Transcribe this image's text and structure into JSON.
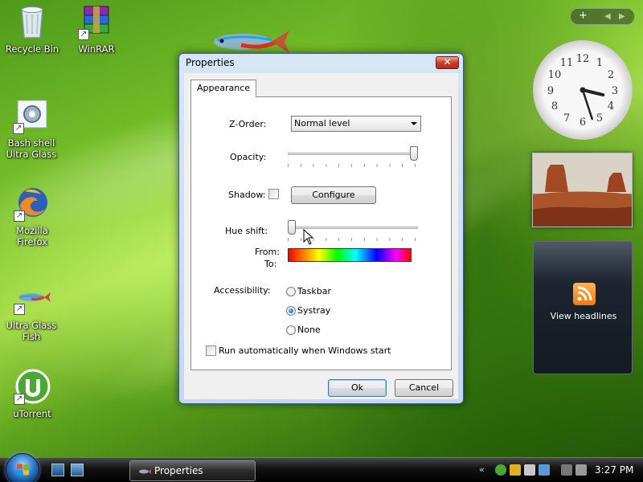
{
  "desktop": {
    "icons": [
      {
        "label": "Recycle Bin"
      },
      {
        "label": "WinRAR"
      },
      {
        "label": "Bash shell Ultra Glass"
      },
      {
        "label": "Mozilla Firefox"
      },
      {
        "label": "Ultra Glass Fish"
      },
      {
        "label": "uTorrent"
      }
    ]
  },
  "dialog": {
    "title": "Properties",
    "close_label": "✕",
    "tab": "Appearance",
    "zorder_label": "Z-Order:",
    "zorder_value": "Normal level",
    "opacity_label": "Opacity:",
    "opacity_value": 1.0,
    "shadow_label": "Shadow:",
    "configure_label": "Configure",
    "hue_label": "Hue shift:",
    "hue_value": 0,
    "from_label": "From:",
    "to_label": "To:",
    "accessibility_label": "Accessibility:",
    "radio_options": [
      "Taskbar",
      "Systray",
      "None"
    ],
    "radio_selected": "Systray",
    "autorun_label": "Run automatically when Windows start",
    "ok_label": "Ok",
    "cancel_label": "Cancel"
  },
  "sidebar": {
    "feeds_label": "View headlines",
    "clock": {
      "hour": 3,
      "minute": 27
    }
  },
  "taskbar": {
    "task_label": "Properties",
    "time": "3:27 PM"
  }
}
